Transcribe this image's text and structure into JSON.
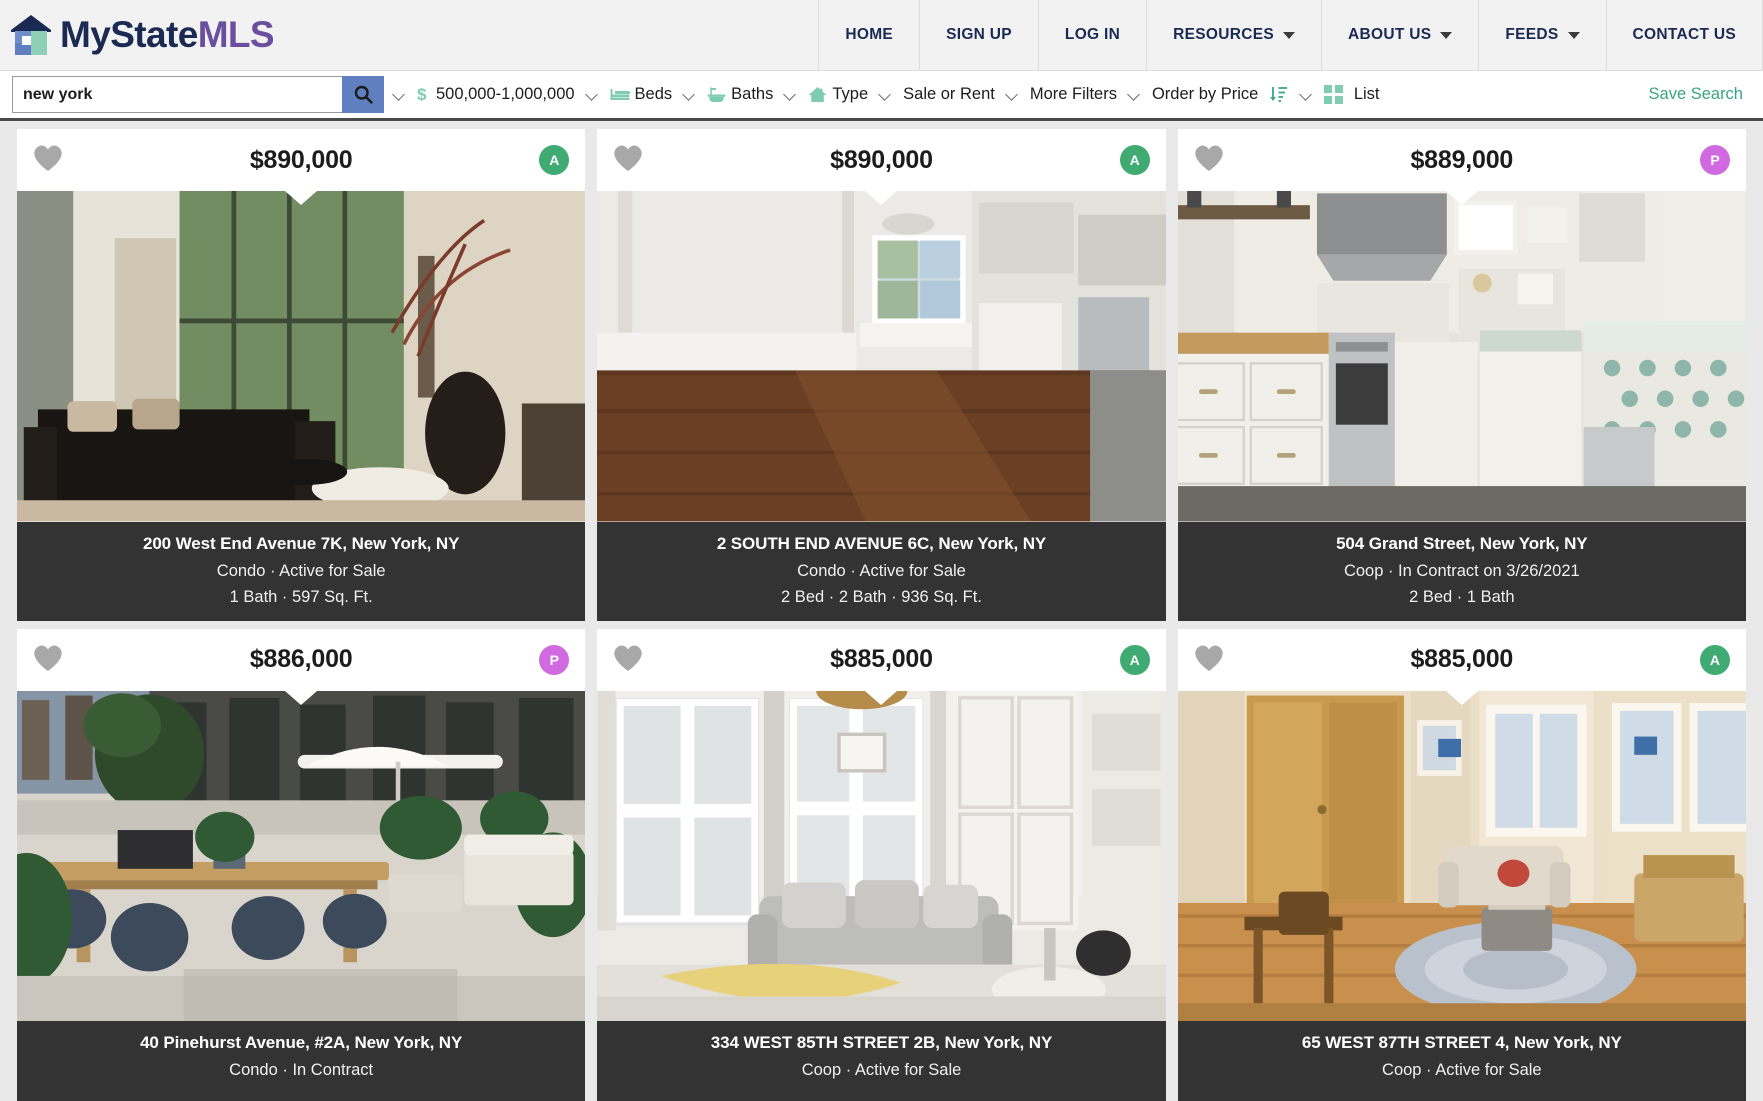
{
  "brand": {
    "name_part1": "My",
    "name_part2": "State",
    "name_part3": "MLS",
    "navy": "#1b2a52",
    "purple": "#6b4f9e",
    "teal": "#8ecfb8"
  },
  "nav": {
    "items": [
      {
        "label": "HOME",
        "has_caret": false
      },
      {
        "label": "SIGN UP",
        "has_caret": false
      },
      {
        "label": "LOG IN",
        "has_caret": false
      },
      {
        "label": "RESOURCES",
        "has_caret": true
      },
      {
        "label": "ABOUT US",
        "has_caret": true
      },
      {
        "label": "FEEDS",
        "has_caret": true
      },
      {
        "label": "CONTACT US",
        "has_caret": false
      }
    ]
  },
  "search": {
    "value": "new york",
    "placeholder": "Search",
    "button_icon": "search-icon",
    "button_color": "#5f7fc0"
  },
  "filters": {
    "price": {
      "label": "500,000-1,000,000",
      "icon": "dollar-icon"
    },
    "beds": {
      "label": "Beds",
      "icon": "bed-icon"
    },
    "baths": {
      "label": "Baths",
      "icon": "bath-icon"
    },
    "type": {
      "label": "Type",
      "icon": "house-icon"
    },
    "sale_or_rent": {
      "label": "Sale or Rent",
      "icon": ""
    },
    "more_filters": {
      "label": "More Filters",
      "icon": ""
    },
    "order_by": {
      "label": "Order by Price",
      "icon": "sort-descending-icon"
    },
    "view": {
      "label": "List",
      "icon": "grid-icon"
    },
    "save_search": {
      "label": "Save Search",
      "color": "#3aa57e"
    }
  },
  "listings": [
    {
      "price": "$890,000",
      "badge": "A",
      "badge_color": "#3faa72",
      "address": "200 West End Avenue 7K, New York, NY",
      "meta": "Condo · Active for Sale",
      "specs": "1 Bath · 597 Sq. Ft.",
      "photo": "living-room-dark-sofa"
    },
    {
      "price": "$890,000",
      "badge": "A",
      "badge_color": "#3faa72",
      "address": "2 SOUTH END AVENUE 6C, New York, NY",
      "meta": "Condo · Active for Sale",
      "specs": "2 Bed · 2 Bath · 936 Sq. Ft.",
      "photo": "empty-room-wood-floor"
    },
    {
      "price": "$889,000",
      "badge": "P",
      "badge_color": "#d16ae0",
      "address": "504 Grand Street, New York, NY",
      "meta": "Coop · In Contract on 3/26/2021",
      "specs": "2 Bed · 1 Bath",
      "photo": "kitchen-white-cabinets"
    },
    {
      "price": "$886,000",
      "badge": "P",
      "badge_color": "#d16ae0",
      "address": "40 Pinehurst Avenue, #2A, New York, NY",
      "meta": "Condo · In Contract",
      "specs": "",
      "photo": "terrace-patio-plants"
    },
    {
      "price": "$885,000",
      "badge": "A",
      "badge_color": "#3faa72",
      "address": "334 WEST 85TH STREET 2B, New York, NY",
      "meta": "Coop · Active for Sale",
      "specs": "",
      "photo": "living-room-gray-sofa"
    },
    {
      "price": "$885,000",
      "badge": "A",
      "badge_color": "#3faa72",
      "address": "65 WEST 87TH STREET 4, New York, NY",
      "meta": "Coop · Active for Sale",
      "specs": "",
      "photo": "living-room-wood-floor-rug"
    }
  ]
}
